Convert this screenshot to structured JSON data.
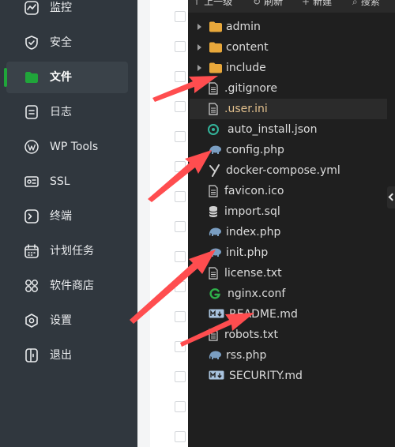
{
  "sidebar": {
    "items": [
      {
        "label": "监控",
        "icon": "monitor-icon",
        "active": false
      },
      {
        "label": "安全",
        "icon": "shield-icon",
        "active": false
      },
      {
        "label": "文件",
        "icon": "folder-icon",
        "active": true
      },
      {
        "label": "日志",
        "icon": "log-icon",
        "active": false
      },
      {
        "label": "WP Tools",
        "icon": "wordpress-icon",
        "active": false
      },
      {
        "label": "SSL",
        "icon": "certificate-icon",
        "active": false
      },
      {
        "label": "终端",
        "icon": "terminal-icon",
        "active": false
      },
      {
        "label": "计划任务",
        "icon": "calendar-icon",
        "active": false
      },
      {
        "label": "软件商店",
        "icon": "apps-icon",
        "active": false
      },
      {
        "label": "设置",
        "icon": "settings-icon",
        "active": false
      },
      {
        "label": "退出",
        "icon": "logout-icon",
        "active": false
      }
    ]
  },
  "toolbar": {
    "up_glyph": "↑",
    "up": "上一级",
    "refresh_glyph": "↻",
    "refresh": "刷新",
    "new_glyph": "+",
    "new": "新建",
    "search_glyph": "⌕",
    "search": "搜索"
  },
  "files": [
    {
      "name": "admin",
      "type": "folder"
    },
    {
      "name": "content",
      "type": "folder"
    },
    {
      "name": "include",
      "type": "folder"
    },
    {
      "name": ".gitignore",
      "type": "text"
    },
    {
      "name": ".user.ini",
      "type": "text",
      "selected": true
    },
    {
      "name": "auto_install.json",
      "type": "json"
    },
    {
      "name": "config.php",
      "type": "php"
    },
    {
      "name": "docker-compose.yml",
      "type": "yaml"
    },
    {
      "name": "favicon.ico",
      "type": "text"
    },
    {
      "name": "import.sql",
      "type": "database"
    },
    {
      "name": "index.php",
      "type": "php"
    },
    {
      "name": "init.php",
      "type": "php"
    },
    {
      "name": "license.txt",
      "type": "text"
    },
    {
      "name": "nginx.conf",
      "type": "nginx"
    },
    {
      "name": "README.md",
      "type": "markdown"
    },
    {
      "name": "robots.txt",
      "type": "text"
    },
    {
      "name": "rss.php",
      "type": "php"
    },
    {
      "name": "SECURITY.md",
      "type": "markdown"
    }
  ],
  "colors": {
    "sidebar_bg": "#30373e",
    "accent_green": "#20a53a",
    "explorer_bg": "#1f1f1f",
    "folder": "#e8a83b",
    "highlight_text": "#e2c08d",
    "annotation_arrow": "#ff4d4f"
  }
}
